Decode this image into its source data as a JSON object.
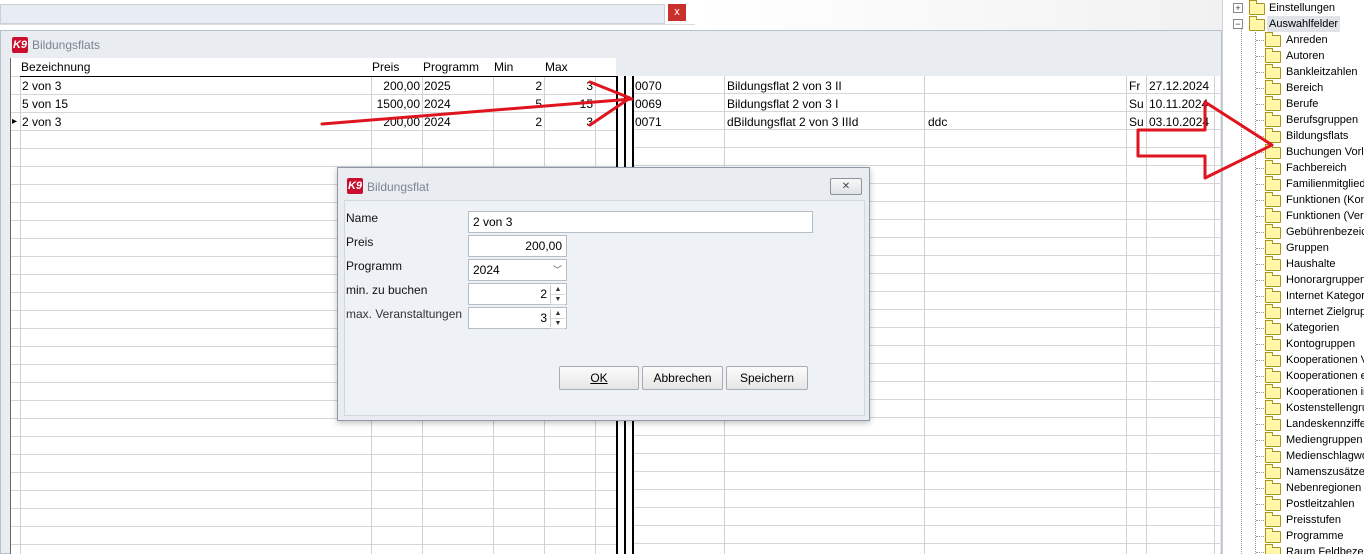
{
  "top_window": {
    "close_label": "x"
  },
  "main_window": {
    "title": "Bildungsflats",
    "logo_text": "K9",
    "left_table": {
      "headers": {
        "bezeichnung": "Bezeichnung",
        "preis": "Preis",
        "programm": "Programm",
        "min": "Min",
        "max": "Max"
      },
      "rows": [
        {
          "bezeichnung": "2 von 3",
          "preis": "200,00",
          "programm": "2025",
          "min": "2",
          "max": "3"
        },
        {
          "bezeichnung": "5 von 15",
          "preis": "1500,00",
          "programm": "2024",
          "min": "5",
          "max": "15"
        },
        {
          "bezeichnung": "2 von 3",
          "preis": "200,00",
          "programm": "2024",
          "min": "2",
          "max": "3"
        }
      ],
      "current_row_marker": "▸"
    },
    "right_table": {
      "rows": [
        {
          "id": "0070",
          "name": "Bildungsflat 2 von 3 II",
          "extra": "",
          "day": "Fr",
          "date": "27.12.2024"
        },
        {
          "id": "0069",
          "name": "Bildungsflat 2 von 3 I",
          "extra": "",
          "day": "Su",
          "date": "10.11.2024"
        },
        {
          "id": "0071",
          "name": "dBildungsflat 2 von 3 IIId",
          "extra": "ddc",
          "day": "Su",
          "date": "03.10.2024"
        }
      ]
    }
  },
  "dialog": {
    "title": "Bildungsflat",
    "close_label": "✕",
    "fields": {
      "name_label": "Name",
      "name_value": "2 von 3",
      "preis_label": "Preis",
      "preis_value": "200,00",
      "programm_label": "Programm",
      "programm_value": "2024",
      "min_label": "min. zu buchen",
      "min_value": "2",
      "max_label": "max. Veranstaltungen",
      "max_value": "3"
    },
    "buttons": {
      "ok": "OK",
      "abbrechen": "Abbrechen",
      "speichern": "Speichern"
    }
  },
  "tree": {
    "root_items": [
      {
        "label": "Einstellungen",
        "expander": "+"
      },
      {
        "label": "Auswahlfelder",
        "expander": "−"
      }
    ],
    "children": [
      "Anreden",
      "Autoren",
      "Bankleitzahlen",
      "Bereich",
      "Berufe",
      "Berufsgruppen",
      "Bildungsflats",
      "Buchungen Vorl",
      "Fachbereich",
      "Familienmitglieder",
      "Funktionen (Kon",
      "Funktionen (Vers",
      "Gebührenbezeic",
      "Gruppen",
      "Haushalte",
      "Honorargruppen",
      "Internet Kategor",
      "Internet Zielgrup",
      "Kategorien",
      "Kontogruppen",
      "Kooperationen V",
      "Kooperationen e",
      "Kooperationen in",
      "Kostenstellengru",
      "Landeskennziffe",
      "Mediengruppen",
      "Medienschlagwo",
      "Namenszusätze",
      "Nebenregionen",
      "Postleitzahlen",
      "Preisstufen",
      "Programme",
      "Raum Feldbezei"
    ]
  },
  "annotations": {
    "arrow_color": "#e0141e"
  }
}
